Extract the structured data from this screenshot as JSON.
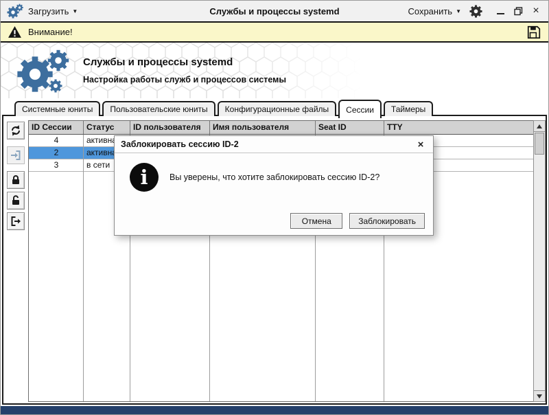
{
  "titlebar": {
    "load_menu": "Загрузить",
    "title": "Службы и процессы systemd",
    "save_menu": "Сохранить"
  },
  "warning_bar": {
    "label": "Внимание!"
  },
  "header": {
    "title": "Службы и процессы systemd",
    "subtitle": "Настройка работы служб и процессов системы"
  },
  "tabs": [
    {
      "label": "Системные юниты",
      "active": false
    },
    {
      "label": "Пользовательские юниты",
      "active": false
    },
    {
      "label": "Конфигурационные файлы",
      "active": false
    },
    {
      "label": "Сессии",
      "active": true
    },
    {
      "label": "Таймеры",
      "active": false
    }
  ],
  "toolbar": {
    "buttons": [
      {
        "icon": "refresh-icon",
        "disabled": false
      },
      {
        "icon": "enter-session-icon",
        "disabled": true
      },
      {
        "icon": "lock-icon",
        "disabled": false
      },
      {
        "icon": "unlock-icon",
        "disabled": false
      },
      {
        "icon": "logout-icon",
        "disabled": false
      }
    ]
  },
  "sessions_table": {
    "columns": [
      "ID Сессии",
      "Статус",
      "ID пользователя",
      "Имя пользователя",
      "Seat ID",
      "TTY"
    ],
    "rows": [
      {
        "session_id": "4",
        "status": "активна",
        "selected": false
      },
      {
        "session_id": "2",
        "status": "активна",
        "selected": true
      },
      {
        "session_id": "3",
        "status": "в сети",
        "selected": false
      }
    ]
  },
  "dialog": {
    "title": "Заблокировать сессию ID-2",
    "message": "Вы уверены, что хотите заблокировать сессию ID-2?",
    "buttons": {
      "cancel": "Отмена",
      "confirm": "Заблокировать"
    }
  },
  "colors": {
    "accent_gear_blue": "#3d6e9e",
    "selected_row_blue": "#4f97dc",
    "warning_bg": "#faf7c9",
    "bottom_bar_navy": "#24406b"
  }
}
